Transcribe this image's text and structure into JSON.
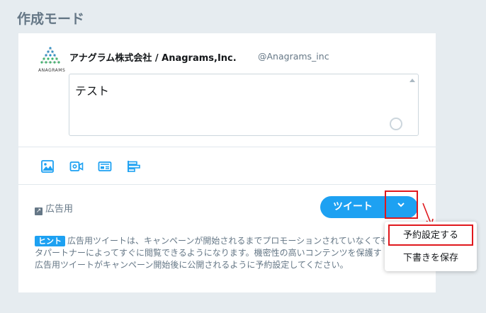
{
  "page_title": "作成モード",
  "account": {
    "logo_text": "ANAGRAMS",
    "name": "アナグラム株式会社 / Anagrams,Inc.",
    "handle": "@Anagrams_inc"
  },
  "composer": {
    "text": "テスト"
  },
  "toolbar": {
    "icons": [
      "image-icon",
      "video-icon",
      "card-icon",
      "poll-icon"
    ]
  },
  "ad_toggle": {
    "label": "広告用"
  },
  "tweet_button": {
    "label": "ツイート"
  },
  "hint": {
    "badge": "ヒント",
    "line1": "広告用ツイートは、キャンペーンが開始されるまでプロモーションされていなくても",
    "line2": "タパートナーによってすぐに閲覧できるようになります。機密性の高いコンテンツを保護す",
    "line3": "広告用ツイートがキャンペーン開始後に公開されるように予約設定してください。"
  },
  "dropdown_menu": {
    "items": [
      "予約設定する",
      "下書きを保存"
    ]
  },
  "colors": {
    "accent": "#1da1f2",
    "highlight": "#e0181d",
    "background": "#e6ecf0"
  }
}
